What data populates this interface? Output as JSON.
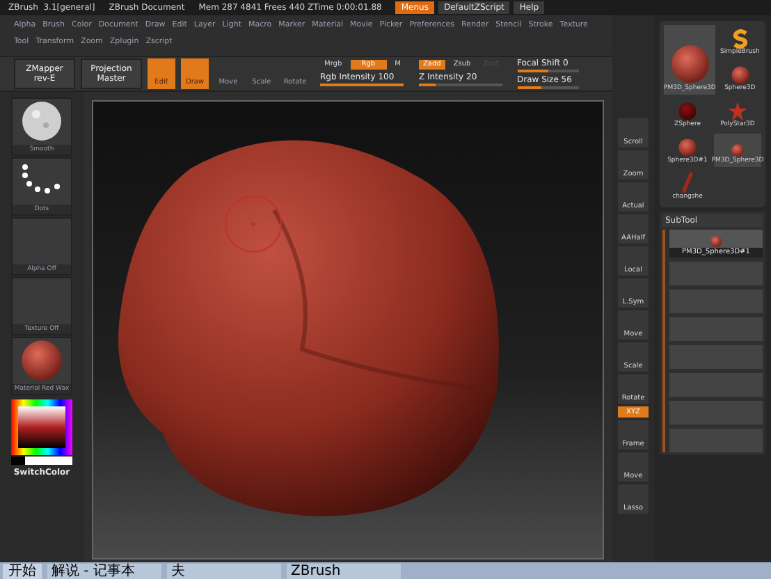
{
  "title_bar": {
    "app": "ZBrush  3.1[general]",
    "document": "ZBrush Document",
    "stats": "Mem 287 4841 Frees 440 ZTime 0:00:01.88",
    "buttons": [
      {
        "label": "Menus",
        "selected": true
      },
      {
        "label": "DefaultZScript",
        "selected": false
      },
      {
        "label": "Help",
        "selected": false
      }
    ]
  },
  "menu_rows": [
    [
      "Alpha",
      "Brush",
      "Color",
      "Document",
      "Draw",
      "Edit",
      "Layer",
      "Light",
      "Macro",
      "Marker",
      "Material",
      "Movie",
      "Picker",
      "Preferences",
      "Render",
      "Stencil",
      "Stroke",
      "Texture"
    ],
    [
      "Tool",
      "Transform",
      "Zoom",
      "Zplugin",
      "Zscript"
    ]
  ],
  "toolbar": {
    "plugins": [
      {
        "line1": "ZMapper",
        "line2": "rev-E"
      },
      {
        "line1": "Projection",
        "line2": "Master"
      }
    ],
    "modes": [
      {
        "label": "Edit",
        "selected": true
      },
      {
        "label": "Draw",
        "selected": true
      },
      {
        "label": "Move",
        "selected": false
      },
      {
        "label": "Scale",
        "selected": false
      },
      {
        "label": "Rotate",
        "selected": false
      }
    ],
    "color_modes": [
      {
        "label": "Mrgb",
        "selected": false
      },
      {
        "label": "Rgb",
        "selected": true
      },
      {
        "label": "M",
        "selected": false
      }
    ],
    "rgb_intensity": {
      "label": "Rgb Intensity 100",
      "level": 1
    },
    "z_modes": [
      {
        "label": "Zadd",
        "selected": true
      },
      {
        "label": "Zsub",
        "selected": false
      },
      {
        "label": "Zcut",
        "selected": false
      }
    ],
    "z_intensity": {
      "label": "Z Intensity 20",
      "level": 0.2
    },
    "focal_shift": {
      "label": "Focal Shift 0",
      "level": 0.5
    },
    "draw_size": {
      "label": "Draw Size 56",
      "level": 0.4
    }
  },
  "left_panel": [
    {
      "kind": "sphere",
      "label": "Smooth"
    },
    {
      "kind": "dots",
      "label": "Dots"
    },
    {
      "kind": "empty",
      "label": "Alpha Off"
    },
    {
      "kind": "empty",
      "label": "Texture Off"
    },
    {
      "kind": "material",
      "label": "Material Red Wax"
    }
  ],
  "color_picker": {
    "label": "SwitchColor"
  },
  "shelf": [
    {
      "label": "Scroll",
      "selected": false
    },
    {
      "label": "Zoom",
      "selected": false
    },
    {
      "label": "Actual",
      "selected": false
    },
    {
      "label": "AAHalf",
      "selected": false
    },
    {
      "label": "Local",
      "selected": false
    },
    {
      "label": "L.Sym",
      "selected": false
    },
    {
      "label": "Move",
      "selected": false
    },
    {
      "label": "Scale",
      "selected": false
    },
    {
      "label": "Rotate",
      "selected": false
    },
    {
      "label": "XYZ",
      "selected": true
    },
    {
      "label": "Frame",
      "selected": false
    },
    {
      "label": "Move",
      "selected": false
    },
    {
      "label": "Lasso",
      "selected": false
    }
  ],
  "tool_palette": {
    "current": {
      "kind": "big",
      "label": "PM3D_Sphere3D"
    },
    "items": [
      {
        "kind": "s",
        "label": "SimpleBrush"
      },
      {
        "kind": "ball",
        "label": "Sphere3D"
      },
      {
        "kind": "dark",
        "label": "ZSphere"
      },
      {
        "kind": "star",
        "label": "PolyStar3D"
      },
      {
        "kind": "ball",
        "label": "Sphere3D#1"
      },
      {
        "kind": "small",
        "label": "PM3D_Sphere3D"
      },
      {
        "kind": "stick",
        "label": "changshe"
      }
    ]
  },
  "subtool": {
    "title": "SubTool",
    "items": [
      "PM3D_Sphere3D#1"
    ]
  },
  "taskbar": {
    "start": "开始",
    "tasks": [
      "解说 - 记事本",
      "夫",
      "ZBrush"
    ]
  }
}
